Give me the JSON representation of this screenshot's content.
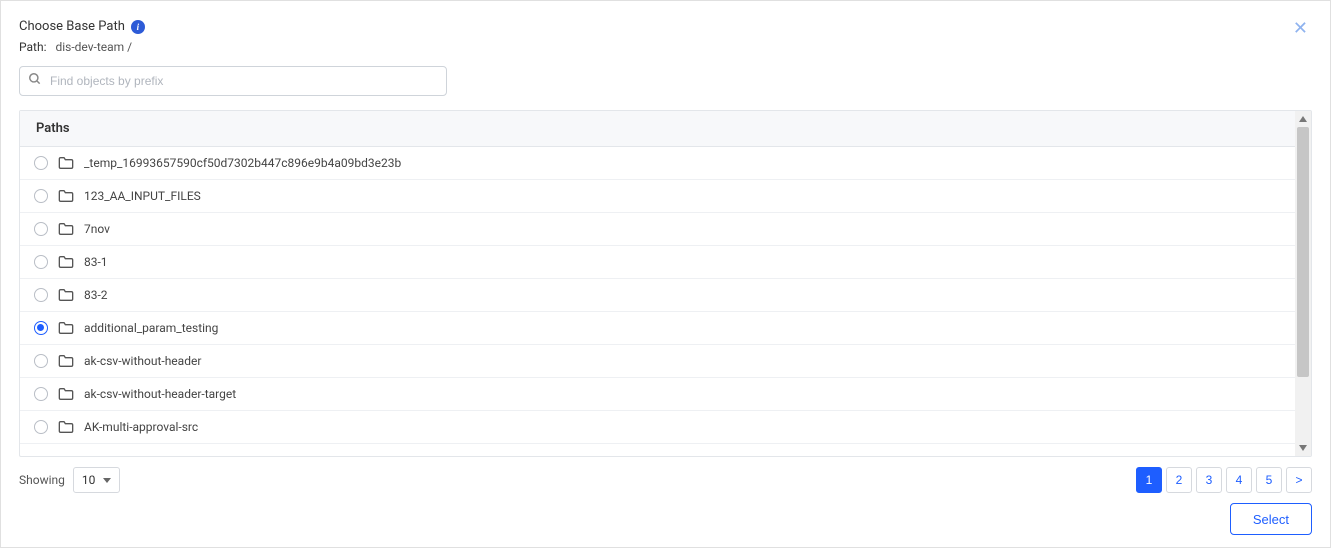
{
  "header": {
    "title": "Choose Base Path",
    "path_label": "Path:",
    "path_value": "dis-dev-team /"
  },
  "search": {
    "placeholder": "Find objects by prefix"
  },
  "table": {
    "header": "Paths",
    "rows": [
      {
        "name": "_temp_16993657590cf50d7302b447c896e9b4a09bd3e23b",
        "selected": false
      },
      {
        "name": "123_AA_INPUT_FILES",
        "selected": false
      },
      {
        "name": "7nov",
        "selected": false
      },
      {
        "name": "83-1",
        "selected": false
      },
      {
        "name": "83-2",
        "selected": false
      },
      {
        "name": "additional_param_testing",
        "selected": true
      },
      {
        "name": "ak-csv-without-header",
        "selected": false
      },
      {
        "name": "ak-csv-without-header-target",
        "selected": false
      },
      {
        "name": "AK-multi-approval-src",
        "selected": false
      }
    ]
  },
  "footer": {
    "showing_label": "Showing",
    "page_size": "10",
    "pages": [
      "1",
      "2",
      "3",
      "4",
      "5",
      ">"
    ],
    "active_page": "1",
    "select_label": "Select"
  }
}
